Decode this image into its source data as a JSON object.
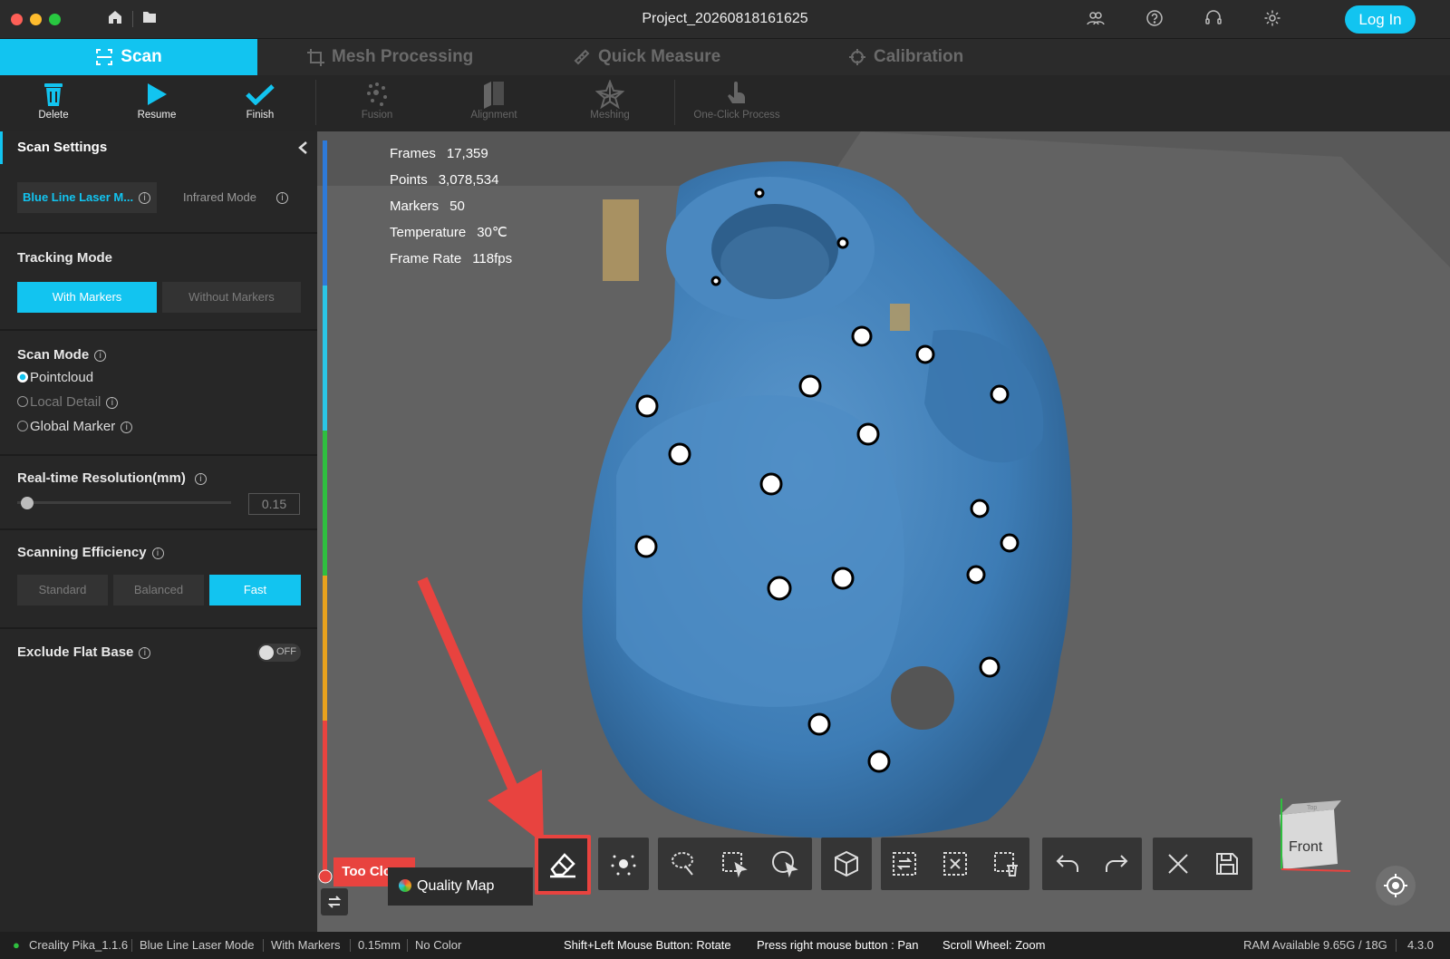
{
  "window": {
    "title": "Project_20260818161625",
    "login_label": "Log In"
  },
  "tabs": [
    {
      "label": "Scan",
      "icon": "scan-icon"
    },
    {
      "label": "Mesh Processing",
      "icon": "mesh-icon"
    },
    {
      "label": "Quick Measure",
      "icon": "ruler-icon"
    },
    {
      "label": "Calibration",
      "icon": "crosshair-icon"
    }
  ],
  "toolbar": {
    "delete": "Delete",
    "resume": "Resume",
    "finish": "Finish",
    "fusion": "Fusion",
    "alignment": "Alignment",
    "meshing": "Meshing",
    "one_click": "One-Click Process"
  },
  "settings": {
    "title": "Scan Settings",
    "laser_mode": "Blue Line Laser M...",
    "infrared_mode": "Infrared Mode",
    "tracking_label": "Tracking Mode",
    "tracking_with": "With Markers",
    "tracking_without": "Without Markers",
    "scan_mode_label": "Scan Mode",
    "scan_modes": [
      "Pointcloud",
      "Local Detail",
      "Global Marker"
    ],
    "resolution_label": "Real-time Resolution(mm)",
    "resolution_value": "0.15",
    "efficiency_label": "Scanning Efficiency",
    "efficiency_options": [
      "Standard",
      "Balanced",
      "Fast"
    ],
    "exclude_label": "Exclude Flat Base",
    "toggle_text": "OFF"
  },
  "stats": [
    {
      "label": "Frames",
      "value": "17,359"
    },
    {
      "label": "Points",
      "value": "3,078,534"
    },
    {
      "label": "Markers",
      "value": "50"
    },
    {
      "label": "Temperature",
      "value": "30℃"
    },
    {
      "label": "Frame Rate",
      "value": "118fps"
    }
  ],
  "viewport": {
    "distance_label": "Too Close",
    "quality_map": "Quality Map",
    "view_cube_face": "Front",
    "view_cube_top": "Top"
  },
  "statusbar": {
    "app": "Creality Pika_1.1.6",
    "mode": "Blue Line Laser Mode",
    "tracking": "With Markers",
    "resolution": "0.15mm",
    "color": "No Color",
    "hint_rotate": "Shift+Left Mouse Button: Rotate",
    "hint_pan": "Press right mouse button : Pan",
    "hint_zoom": "Scroll Wheel: Zoom",
    "ram": "RAM Available 9.65G / 18G",
    "version": "4.3.0"
  },
  "colors": {
    "accent": "#12c4f0",
    "scan_blue": "#3d7cb5",
    "highlight_red": "#e8433f"
  }
}
